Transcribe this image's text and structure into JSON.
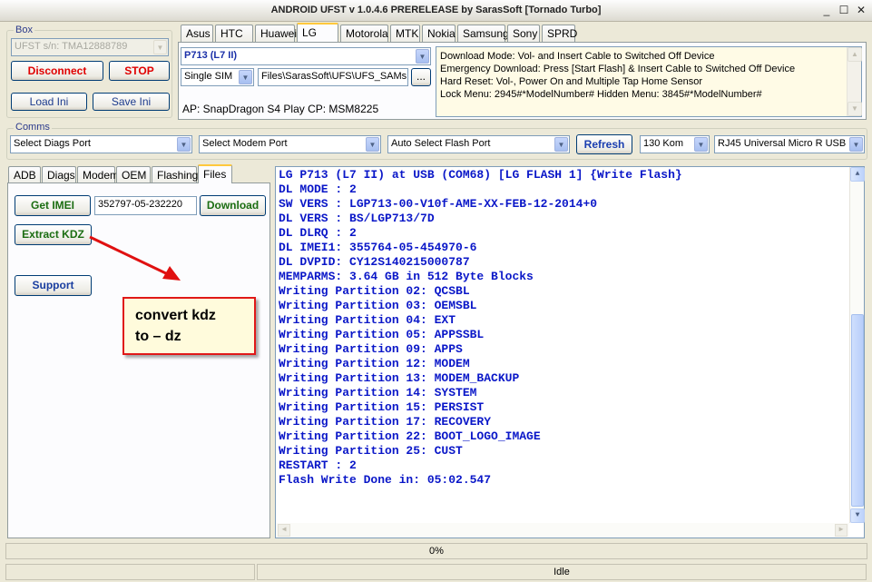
{
  "window": {
    "title": "ANDROID UFST v 1.0.4.6 PRERELEASE by SarasSoft  [Tornado Turbo]",
    "min_symbol": "_",
    "max_symbol": "☐",
    "close_symbol": "✕"
  },
  "box_group": {
    "legend": "Box",
    "serial_combo": "UFST s/n: TMA12888789",
    "disconnect_label": "Disconnect",
    "stop_label": "STOP",
    "load_ini_label": "Load Ini",
    "save_ini_label": "Save Ini"
  },
  "brand_tabs": [
    "Asus",
    "HTC",
    "Huawei",
    "LG",
    "Motorola",
    "MTK",
    "Nokia",
    "Samsung",
    "Sony",
    "SPRD"
  ],
  "brand_active": "LG",
  "lg_panel": {
    "model_combo": "P713 (L7 II)",
    "sim_combo": "Single SIM",
    "path_field": "Files\\SarasSoft\\UFS\\UFS_SAMs",
    "browse_label": "...",
    "platform_info": "AP: SnapDragon S4 Play  CP: MSM8225",
    "info_lines": [
      "Download Mode: Vol- and Insert Cable to Switched Off Device",
      "Emergency Download: Press [Start Flash] & Insert Cable to Switched Off Device",
      "Hard Reset: Vol-, Power On and Multiple Tap Home Sensor",
      "Lock Menu: 2945#*ModelNumber#   Hidden Menu: 3845#*ModelNumber#"
    ]
  },
  "comms": {
    "legend": "Comms",
    "diags_port": "Select Diags Port",
    "modem_port": "Select Modem Port",
    "flash_port": "Auto Select Flash Port",
    "refresh_label": "Refresh",
    "speed": "130 Kom",
    "cable": "RJ45 Universal Micro R USB"
  },
  "func_tabs": [
    "ADB",
    "Diags",
    "Modem",
    "OEM",
    "Flashing",
    "Files"
  ],
  "func_active": "Files",
  "files_panel": {
    "get_imei_label": "Get IMEI",
    "imei_value": "352797-05-232220",
    "download_label": "Download",
    "extract_kdz_label": "Extract KDZ",
    "support_label": "Support"
  },
  "annotation": {
    "line1": "convert kdz",
    "line2": "to – dz"
  },
  "log_lines": [
    "LG P713 (L7 II) at USB (COM68) [LG FLASH 1] {Write Flash}",
    "DL MODE : 2",
    "SW VERS : LGP713-00-V10f-AME-XX-FEB-12-2014+0",
    "DL VERS : BS/LGP713/7D",
    "DL DLRQ : 2",
    "DL IMEI1: 355764-05-454970-6",
    "DL DVPID: CY12S140215000787",
    "MEMPARMS: 3.64 GB in 512 Byte Blocks",
    "Writing Partition 02: QCSBL",
    "Writing Partition 03: OEMSBL",
    "Writing Partition 04: EXT",
    "Writing Partition 05: APPSSBL",
    "Writing Partition 09: APPS",
    "Writing Partition 12: MODEM",
    "Writing Partition 13: MODEM_BACKUP",
    "Writing Partition 14: SYSTEM",
    "Writing Partition 15: PERSIST",
    "Writing Partition 17: RECOVERY",
    "Writing Partition 22: BOOT_LOGO_IMAGE",
    "Writing Partition 25: CUST",
    "RESTART : 2",
    "Flash Write Done in: 05:02.547"
  ],
  "progress": {
    "text": "0%",
    "fraction": 0
  },
  "status": {
    "text": "Idle"
  },
  "icons": {
    "scroll_up": "▲",
    "scroll_down": "▼",
    "combo_arrow": "▼"
  }
}
